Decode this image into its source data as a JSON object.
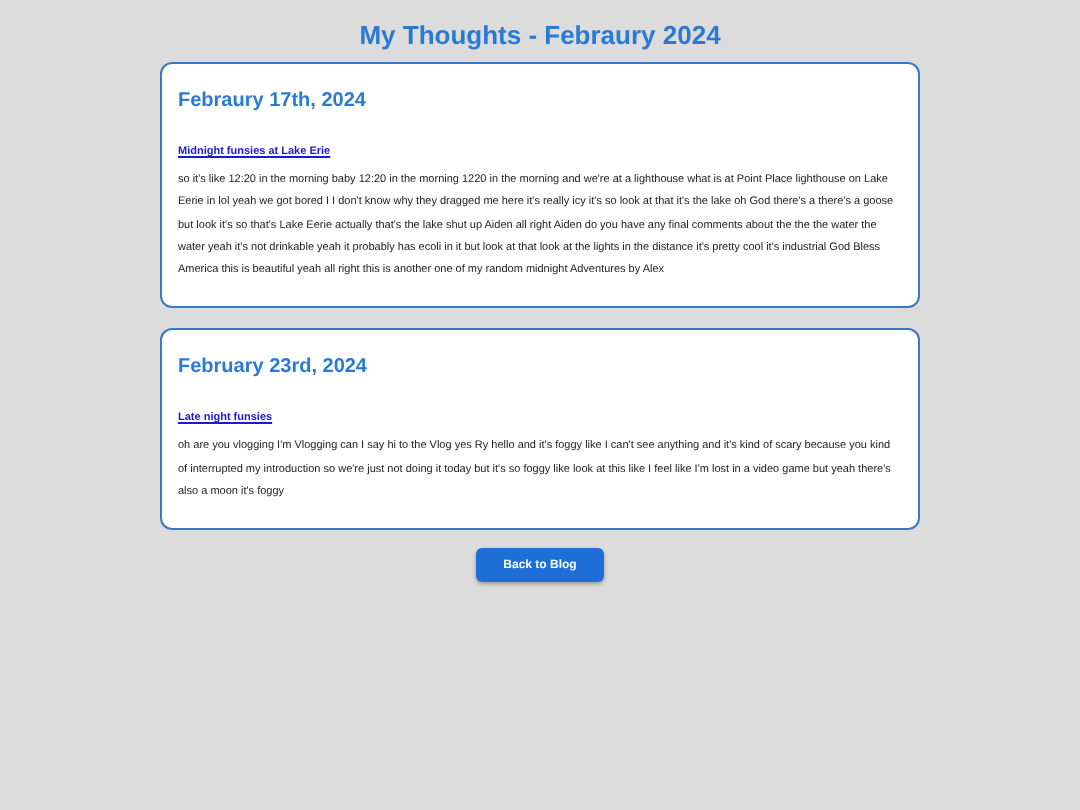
{
  "title": "My Thoughts - Febraury 2024",
  "posts": [
    {
      "date": "Febraury 17th, 2024",
      "link": "Midnight funsies at Lake Erie",
      "body": "so it's like 12:20 in the morning baby 12:20 in the morning 1220 in the morning and we're at a lighthouse what is at Point Place lighthouse on Lake Eerie in lol yeah we got bored I I don't know why they dragged me here it's really icy it's so look at that it's the lake oh God there's a there's a goose but look it's so that's Lake Eerie actually that's the lake shut up Aiden all right Aiden do you have any final comments about the the the water the water yeah it's not drinkable yeah it probably has ecoli in it but look at that look at the lights in the distance it's pretty cool it's industrial God Bless America this is beautiful yeah all right this is another one of my random midnight Adventures by Alex"
    },
    {
      "date": "February 23rd, 2024",
      "link": "Late night funsies",
      "body": "oh are you vlogging I'm Vlogging can I say hi to the Vlog yes Ry hello and it's foggy like I can't see anything and it's kind of scary because you kind of interrupted my introduction so we're just not doing it today but it's so foggy like look at this like I feel like I'm lost in a video game but yeah there's also a moon it's foggy"
    }
  ],
  "back_button": "Back to Blog"
}
